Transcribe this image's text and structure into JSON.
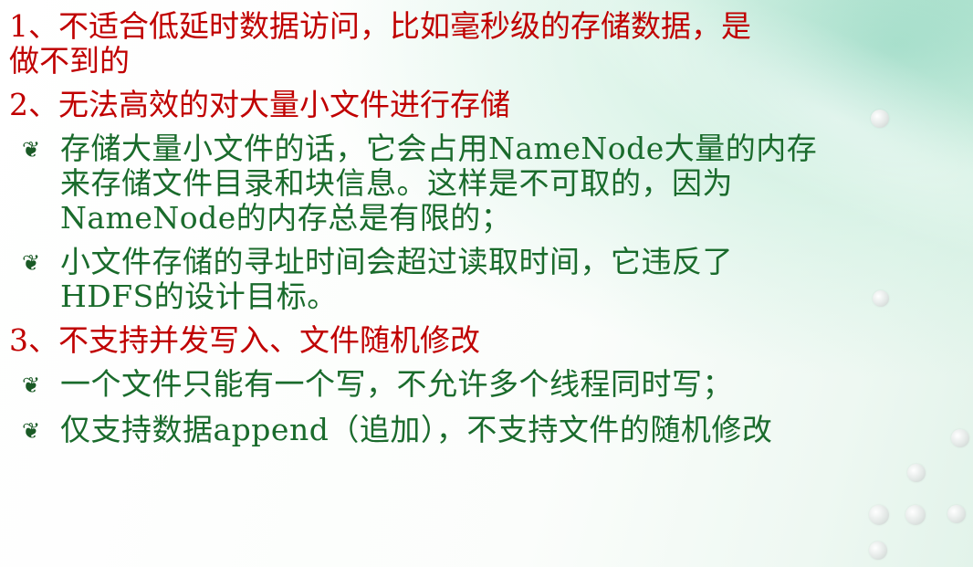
{
  "colors": {
    "heading": "#c00000",
    "bullet_text": "#1a6b2c"
  },
  "bullet_icon": "sprout-bullet-icon",
  "sections": [
    {
      "heading_lines": [
        "1、不适合低延时数据访问，比如毫秒级的存储数据，是",
        "做不到的"
      ],
      "bullets": []
    },
    {
      "heading_lines": [
        "2、无法高效的对大量小文件进行存储"
      ],
      "bullets": [
        {
          "mark": "❦",
          "lines": [
            "存储大量小文件的话，它会占用NameNode大量的内存",
            "来存储文件目录和块信息。这样是不可取的，因为",
            "NameNode的内存总是有限的；"
          ]
        },
        {
          "mark": "❦",
          "lines": [
            "小文件存储的寻址时间会超过读取时间，它违反了",
            "HDFS的设计目标。"
          ]
        }
      ]
    },
    {
      "heading_lines": [
        "3、不支持并发写入、文件随机修改"
      ],
      "bullets": [
        {
          "mark": "❦",
          "lines": [
            "一个文件只能有一个写，不允许多个线程同时写；"
          ]
        },
        {
          "mark": "❦",
          "lines": [
            "仅支持数据append（追加），不支持文件的随机修改"
          ]
        }
      ]
    }
  ]
}
